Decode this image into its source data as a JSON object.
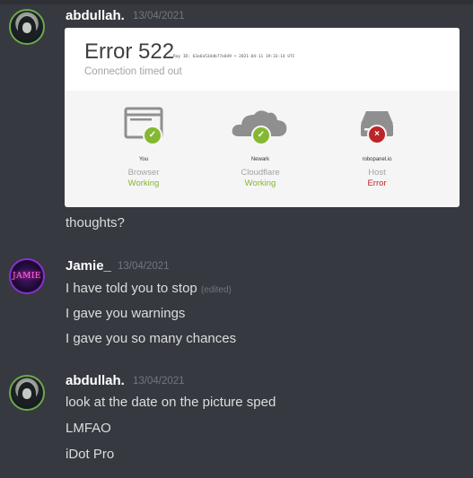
{
  "messages": [
    {
      "author": "abdullah.",
      "timestamp": "13/04/2021",
      "embed": {
        "error_title": "Error 522",
        "ray_info": "Ray ID: 63e6a53ddb77e849 • 2021-04-11 19:33:14 UTC",
        "subtitle": "Connection timed out",
        "nodes": [
          {
            "name": "You",
            "role": "Browser",
            "status": "Working",
            "state": "ok",
            "icon": "browser-icon"
          },
          {
            "name": "Newark",
            "role": "Cloudflare",
            "status": "Working",
            "state": "ok",
            "icon": "cloud-icon"
          },
          {
            "name": "robopanel.io",
            "role": "Host",
            "status": "Error",
            "state": "error",
            "icon": "server-icon"
          }
        ]
      },
      "lines": [
        "thoughts?"
      ]
    },
    {
      "author": "Jamie_",
      "timestamp": "13/04/2021",
      "avatar_text": "JAMIE",
      "lines": [
        "I have told you to stop",
        "I gave you warnings",
        "I gave you so many chances"
      ],
      "edited_label": "(edited)"
    },
    {
      "author": "abdullah.",
      "timestamp": "13/04/2021",
      "lines": [
        "look at the date on the picture sped",
        "LMFAO",
        "iDot Pro"
      ]
    }
  ],
  "colors": {
    "background": "#36393f",
    "username": "#ffffff",
    "timestamp": "#72767d",
    "text": "#dcddde",
    "ok": "#85b832",
    "error": "#bd2426"
  }
}
